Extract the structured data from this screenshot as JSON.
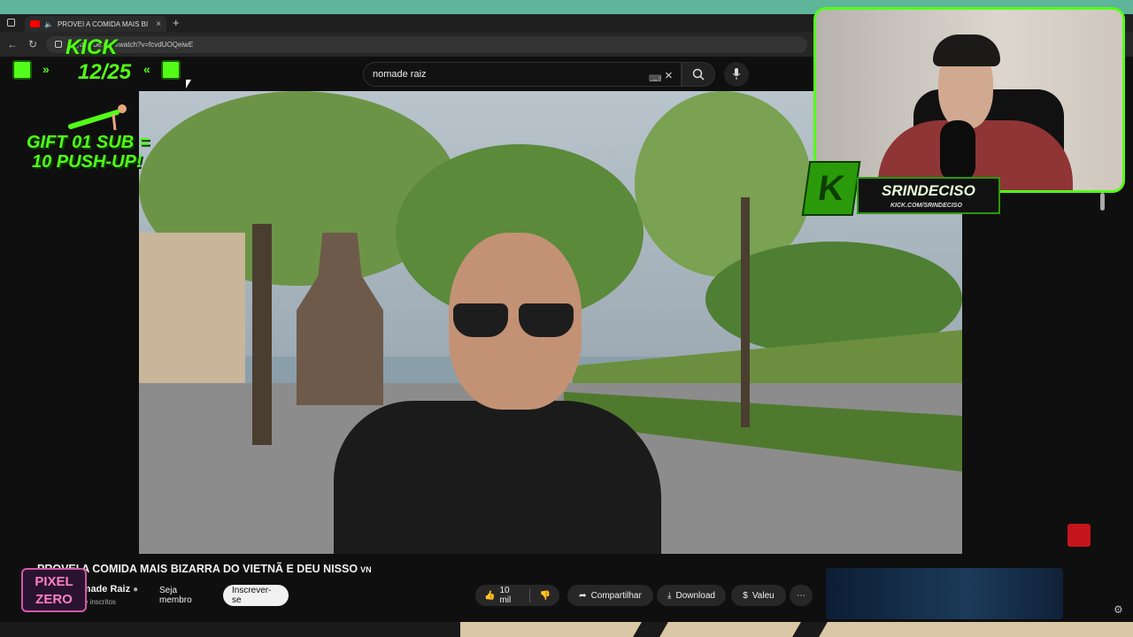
{
  "browser": {
    "tab_title": "PROVEI A COMIDA MAIS BI",
    "new_tab": "+",
    "url": "youtube.com/watch?v=fcvdUOQeiwE"
  },
  "search": {
    "value": "nomade raiz"
  },
  "overlay": {
    "kick_label": "KICK",
    "sub_goal": "12/25",
    "gift_line1": "GIFT 01 SUB =",
    "gift_line2": "10 PUSH-UP!",
    "streamer_name": "SRINDECISO",
    "streamer_url": "KICK.COM/SRINDECISO",
    "corner_logo_line1": "PIXEL",
    "corner_logo_line2": "ZERO"
  },
  "video": {
    "title": "PROVEI A COMIDA MAIS BIZARRA DO VIETNÃ E DEU NISSO",
    "flag": "VN",
    "channel": "Nomade Raiz",
    "subscribers": "mil de inscritos"
  },
  "actions": {
    "member": "Seja membro",
    "subscribe": "Inscrever-se",
    "likes": "10 mil",
    "share": "Compartilhar",
    "download": "Download",
    "thanks": "Valeu",
    "more": "⋯"
  },
  "colors": {
    "kick_green": "#53fc18",
    "youtube_red": "#ff0000"
  }
}
